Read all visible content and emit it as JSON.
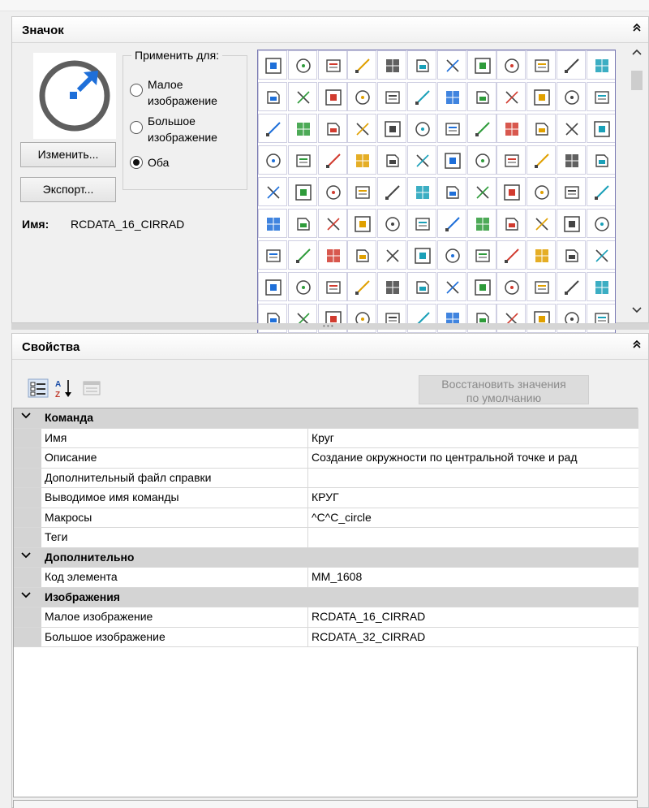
{
  "icon_panel": {
    "title": "Значок",
    "collapse_glyph": "⌃",
    "apply_for_label": "Применить для:",
    "options": [
      {
        "label_line1": "Малое",
        "label_line2": "изображение",
        "selected": false
      },
      {
        "label_line1": "Большое",
        "label_line2": "изображение",
        "selected": false
      },
      {
        "label_line1": "Оба",
        "label_line2": "",
        "selected": true
      }
    ],
    "edit_button": "Изменить...",
    "export_button": "Экспорт...",
    "name_label": "Имя:",
    "name_value": "RCDATA_16_CIRRAD",
    "preview_icon": "circle-radius-icon",
    "gallery_icons": [
      "select-icon",
      "region-icon",
      "3dpoly-icon",
      "import-3ds-icon",
      "3d-box-icon",
      "cloud-icon",
      "sparkle-icon",
      "ucs-icon",
      "layers-icon",
      "globe-icon",
      "mirror-icon",
      "remove-icon",
      "dwf-icon",
      "attach-icon",
      "vba-icon",
      "vba-run-icon",
      "vba-edit-icon",
      "frame-lock-icon",
      "frame-icon",
      "boundary-icon",
      "align-icon",
      "circle-ttr-icon",
      "circle-3p-icon",
      "circle-radius-icon",
      "circle-diameter-icon",
      "coins-icon",
      "dots-circle-icon",
      "circle-2p-icon",
      "circle-dashed-icon",
      "clock-icon",
      "clean-icon",
      "clean-remove-icon",
      "erase-list-icon",
      "info-icon",
      "pen-edit-icon",
      "select-green-icon",
      "dashed-select-icon",
      "list-edit-icon",
      "align-left-icon",
      "align-right-icon",
      "bars-icon",
      "bars-high-icon",
      "table-remove-icon",
      "table-icon",
      "table-cyan-icon",
      "table-blue-icon",
      "table-edit-icon",
      "grid-icon",
      "crosshair-icon",
      "building-icon",
      "tree-icon",
      "hierarchy-icon",
      "hierarchy-dash-icon",
      "scroll-icon",
      "text-top-icon",
      "text-center-icon",
      "text-left-icon",
      "text-mid-icon",
      "text-under-icon",
      "text-box-icon",
      "text-bottom-icon",
      "text-bottom-center-icon",
      "text-bottom-right-icon",
      "delete-red-icon",
      "zoom-icon",
      "clock-outline-icon",
      "cui-icon",
      "grid-edit-icon",
      "cui-load-icon",
      "cui-save-icon",
      "pgp-icon",
      "layers-red-icon",
      "check-doc-icon",
      "edit-doc-icon",
      "gear-doc-icon",
      "console-icon",
      "vba-doc-icon",
      "lisp-icon",
      "cube-icon",
      "line-orange-icon",
      "angle-orange-icon",
      "arc-orange-icon",
      "square-dot-icon",
      "circle-dot-icon",
      "point-icon",
      "magnet-icon",
      "magnet-gray-icon",
      "cross-x-icon",
      "intersect-icon",
      "tangent-icon",
      "target-icon",
      "perp-icon",
      "folder-blank-icon",
      "folder-open-icon",
      "floppy-icon",
      "floppy-edit-icon",
      "floppy-web-icon",
      "printer-web-icon",
      "print-list-icon",
      "print-list2-icon",
      "printer-edit-icon",
      "preview-icon",
      "printer-icon",
      "publish-icon",
      "doc-mail-icon",
      "doc-list-icon",
      "arrow-right-icon",
      "copy-icon"
    ],
    "scroll_up": "⌃",
    "scroll_down": "⌄"
  },
  "properties_panel": {
    "title": "Свойства",
    "collapse_glyph": "⌃",
    "restore_button_line1": "Восстановить значения",
    "restore_button_line2": "по умолчанию",
    "toolbar_icons": [
      "categorized-icon",
      "sort-az-icon",
      "property-pages-icon"
    ],
    "sort_label": "A Z",
    "sections": [
      {
        "name": "Команда",
        "rows": [
          {
            "key": "Имя",
            "value": "Круг"
          },
          {
            "key": "Описание",
            "value": "Создание окружности по центральной точке и рад"
          },
          {
            "key": "Дополнительный файл справки",
            "value": ""
          },
          {
            "key": "Выводимое имя команды",
            "value": "КРУГ"
          },
          {
            "key": "Макросы",
            "value": "^C^C_circle"
          },
          {
            "key": "Теги",
            "value": ""
          }
        ]
      },
      {
        "name": "Дополнительно",
        "rows": [
          {
            "key": "Код элемента",
            "value": "MM_1608"
          }
        ]
      },
      {
        "name": "Изображения",
        "rows": [
          {
            "key": "Малое изображение",
            "value": "RCDATA_16_CIRRAD"
          },
          {
            "key": "Большое изображение",
            "value": "RCDATA_32_CIRRAD"
          }
        ]
      }
    ]
  },
  "colors": {
    "accent_blue": "#1e6fd9",
    "grid_border": "#7a7ab3",
    "category_gray": "#d4d4d4"
  }
}
